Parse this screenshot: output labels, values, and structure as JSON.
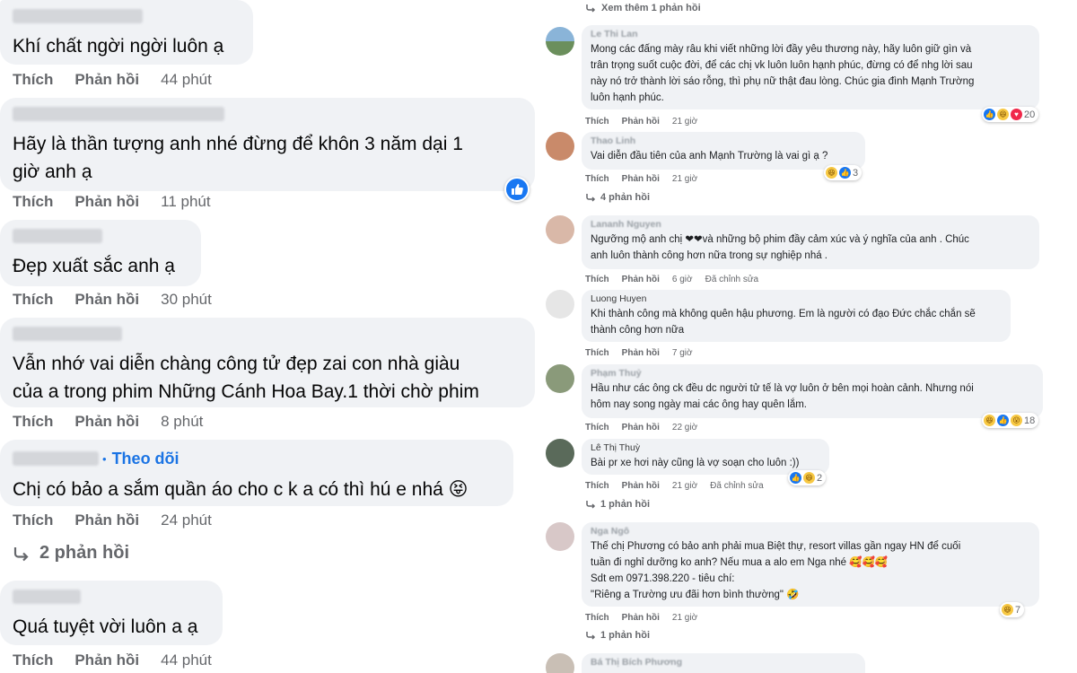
{
  "left_comments": [
    {
      "text": "Khí chất ngời ngời luôn ạ",
      "like": "Thích",
      "reply": "Phản hồi",
      "time": "44 phút"
    },
    {
      "text_line1": "Hãy là thần tượng anh nhé đừng để khôn 3 năm dại 1",
      "text_line2": "giờ anh ạ",
      "like": "Thích",
      "reply": "Phản hồi",
      "time": "11 phút"
    },
    {
      "text": "Đẹp xuất sắc anh ạ",
      "like": "Thích",
      "reply": "Phản hồi",
      "time": "30 phút"
    },
    {
      "text_line1": "Vẫn nhớ vai diễn chàng công tử đẹp zai con nhà giàu",
      "text_line2": "của a trong phim Những Cánh Hoa Bay.1 thời chờ phim",
      "like": "Thích",
      "reply": "Phản hồi",
      "time": "8 phút"
    },
    {
      "follow": "Theo dõi",
      "text": "Chị có bảo a sắm quần áo cho c k a có thì hú e nhá 😝",
      "like": "Thích",
      "reply": "Phản hồi",
      "time": "24 phút",
      "replies": "2 phản hồi"
    },
    {
      "text": "Quá tuyệt vời luôn a ạ",
      "like": "Thích",
      "reply": "Phản hồi",
      "time": "44 phút"
    }
  ],
  "right": {
    "top_more": "Xem thêm 1 phản hồi",
    "comments": [
      {
        "name": "Le Thi Lan",
        "lines": [
          "Mong các đấng mày râu khi viết những lời đầy yêu thương này, hãy luôn giữ gìn và",
          "trân trọng suốt cuộc đời, để các chị vk luôn luôn hạnh phúc, đừng có để nhg lời sau",
          "này nó trở thành lời sáo rỗng, thì phụ nữ thật đau lòng. Chúc gia đình Mạnh Trường",
          "luôn hạnh phúc."
        ],
        "like": "Thích",
        "reply": "Phản hồi",
        "time": "21 giờ",
        "edited": "",
        "react_count": "20"
      },
      {
        "name": "Thao Linh",
        "lines": [
          "Vai diễn đầu tiên của anh Mạnh Trường là vai gì ạ ?"
        ],
        "like": "Thích",
        "reply": "Phản hồi",
        "time": "21 giờ",
        "edited": "",
        "react_count": "3",
        "replies": "4 phản hồi"
      },
      {
        "name": "Lananh Nguyen",
        "lines": [
          "Ngưỡng mộ anh chị ❤❤và những bộ phim đầy cảm xúc và ý nghĩa của anh . Chúc",
          "anh luôn thành công hơn nữa trong sự nghiệp nhá ."
        ],
        "like": "Thích",
        "reply": "Phản hồi",
        "time": "6 giờ",
        "edited": "Đã chỉnh sửa"
      },
      {
        "name": "Luong Huyen",
        "lines": [
          "Khi thành công mà không quên hậu phương. Em là người có đạo Đức chắc chắn sẽ",
          "thành công hơn nữa"
        ],
        "like": "Thích",
        "reply": "Phản hồi",
        "time": "7 giờ",
        "edited": ""
      },
      {
        "name": "Phạm Thuỷ",
        "lines": [
          "Hầu như các ông ck đều dc người tử tế là vợ luôn ở bên mọi hoàn cảnh. Nhưng nói",
          "hôm nay song ngày mai các ông hay quên lắm."
        ],
        "like": "Thích",
        "reply": "Phản hồi",
        "time": "22 giờ",
        "edited": "",
        "react_count": "18"
      },
      {
        "name": "Lê Thị Thuỳ",
        "lines": [
          "Bài pr xe hơi này cũng là vợ soạn cho luôn :))"
        ],
        "like": "Thích",
        "reply": "Phản hồi",
        "time": "21 giờ",
        "edited": "Đã chỉnh sửa",
        "react_count": "2",
        "replies": "1 phản hồi"
      },
      {
        "name": "Nga Ngô",
        "lines": [
          "Thế chị Phương có bảo anh phải mua Biệt thự, resort villas gần ngay HN để cuối",
          "tuần đi nghỉ dưỡng ko anh? Nếu mua a alo em Nga nhé 🥰🥰🥰",
          "Sdt em 0971.398.220 - tiêu chí:",
          "\"Riêng a Trường ưu đãi hơn bình thường\" 🤣"
        ],
        "like": "Thích",
        "reply": "Phản hồi",
        "time": "21 giờ",
        "edited": "",
        "react_count": "7",
        "replies": "1 phản hồi"
      },
      {
        "name": "Bá Thị Bích Phương",
        "lines": []
      }
    ]
  }
}
